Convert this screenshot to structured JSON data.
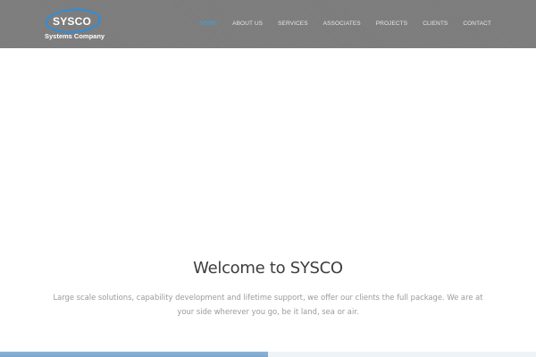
{
  "header": {
    "logo": {
      "name": "SYSCO",
      "tagline": "Systems Company",
      "ring_color": "#2a8fe0"
    },
    "nav": [
      {
        "label": "HOME",
        "active": true
      },
      {
        "label": "ABOUT US",
        "active": false
      },
      {
        "label": "SERVICES",
        "active": false
      },
      {
        "label": "ASSOCIATES",
        "active": false
      },
      {
        "label": "PROJECTS",
        "active": false
      },
      {
        "label": "CLIENTS",
        "active": false
      },
      {
        "label": "CONTACT",
        "active": false
      }
    ],
    "active_color": "#3aa3df",
    "background_color": "#7c7c7c"
  },
  "hero": {
    "title": "Welcome to SYSCO",
    "text": "Large scale solutions, capability development and lifetime support, we offer our clients the full package. We are at your side wherever you go, be it land, sea or air."
  }
}
